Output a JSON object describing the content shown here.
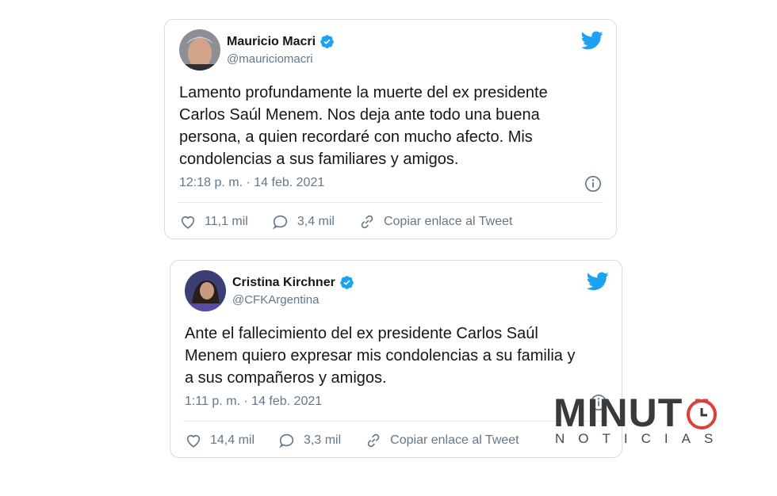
{
  "tweets": [
    {
      "author": {
        "name": "Mauricio Macri",
        "handle": "@mauriciomacri"
      },
      "text_lines": [
        "Lamento profundamente la muerte del ex presidente",
        "Carlos Saúl Menem. Nos deja ante todo una buena",
        "persona, a quien recordaré con mucho afecto. Mis",
        "condolencias a sus familiares y amigos."
      ],
      "timestamp": "12:18 p. m. · 14 feb. 2021",
      "likes": "11,1 mil",
      "replies": "3,4 mil",
      "copy_link": "Copiar enlace al Tweet"
    },
    {
      "author": {
        "name": "Cristina Kirchner",
        "handle": "@CFKArgentina"
      },
      "text_lines": [
        "Ante el fallecimiento del ex presidente Carlos Saúl",
        "Menem quiero expresar mis condolencias a su familia y",
        "a sus compañeros y amigos."
      ],
      "timestamp": "1:11 p. m. · 14 feb. 2021",
      "likes": "14,4 mil",
      "replies": "3,3 mil",
      "copy_link": "Copiar enlace al Tweet"
    }
  ],
  "watermark": {
    "main": "MINUT",
    "sub": "NOTICIAS"
  },
  "colors": {
    "twitter_blue": "#1da1f2",
    "text": "#14171a",
    "secondary": "#657786",
    "border": "#d6dde3",
    "watermark_red": "#d9413a"
  },
  "icons": [
    "verified-badge-icon",
    "twitter-bird-icon",
    "info-icon",
    "heart-icon",
    "reply-bubble-icon",
    "link-icon",
    "clock-icon"
  ]
}
